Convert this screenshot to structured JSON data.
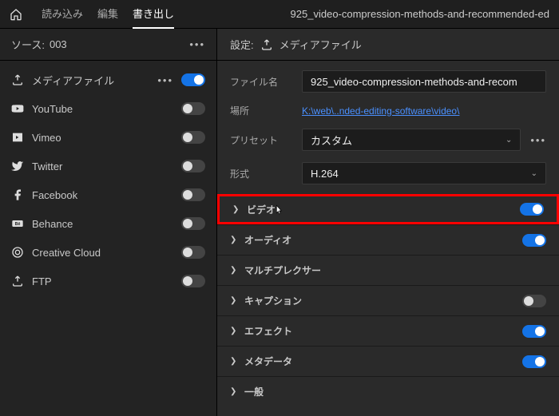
{
  "topbar": {
    "tabs": {
      "load": "読み込み",
      "edit": "編集",
      "export": "書き出し"
    },
    "title": "925_video-compression-methods-and-recommended-ed"
  },
  "left": {
    "source_label": "ソース:",
    "source_value": "003",
    "targets": [
      {
        "name": "メディアファイル",
        "icon": "export",
        "on": true,
        "dots": true
      },
      {
        "name": "YouTube",
        "icon": "youtube",
        "on": false
      },
      {
        "name": "Vimeo",
        "icon": "vimeo",
        "on": false
      },
      {
        "name": "Twitter",
        "icon": "twitter",
        "on": false
      },
      {
        "name": "Facebook",
        "icon": "facebook",
        "on": false
      },
      {
        "name": "Behance",
        "icon": "behance",
        "on": false
      },
      {
        "name": "Creative Cloud",
        "icon": "cc",
        "on": false
      },
      {
        "name": "FTP",
        "icon": "ftp",
        "on": false
      }
    ]
  },
  "right": {
    "settings_label": "設定:",
    "settings_value": "メディアファイル",
    "filename_label": "ファイル名",
    "filename_value": "925_video-compression-methods-and-recom",
    "location_label": "場所",
    "location_value": "K:\\web\\..nded-editing-software\\video\\",
    "preset_label": "プリセット",
    "preset_value": "カスタム",
    "format_label": "形式",
    "format_value": "H.264",
    "sections": [
      {
        "name": "ビデオ",
        "toggle": true,
        "highlight": true
      },
      {
        "name": "オーディオ",
        "toggle": true
      },
      {
        "name": "マルチプレクサー",
        "toggle": null
      },
      {
        "name": "キャプション",
        "toggle": false
      },
      {
        "name": "エフェクト",
        "toggle": true
      },
      {
        "name": "メタデータ",
        "toggle": true
      },
      {
        "name": "一般",
        "toggle": null
      }
    ]
  }
}
